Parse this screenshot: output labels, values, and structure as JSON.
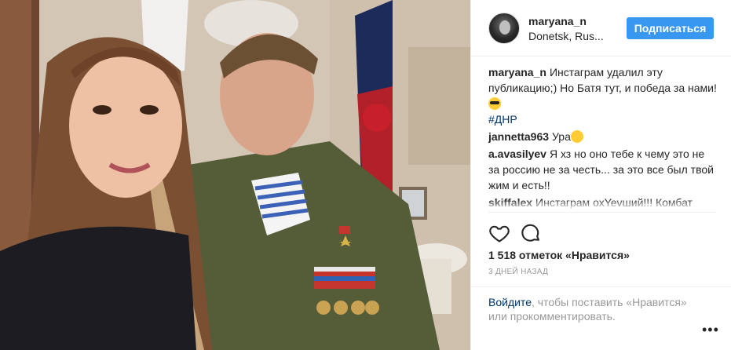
{
  "post": {
    "username": "maryana_n",
    "location": "Donetsk, Rus...",
    "follow_label": "Подписаться"
  },
  "comments": [
    {
      "user": "maryana_n",
      "text": "Инстаграм удалил эту публикацию;) Но Батя тут, и победа за нами!",
      "emoji": "smiling-face-with-sunglasses",
      "hashtag": "#ДНР"
    },
    {
      "user": "jannetta963",
      "text": "Ура",
      "emoji": "smiling-face"
    },
    {
      "user": "a.avasilyev",
      "text": "Я хз но оно тебе к чему это не за россию не за честь... за это все был твой жим и есть!!"
    },
    {
      "user": "skiffalex",
      "text": "Инстаграм охYevший!!! Комбат батяня!!!!"
    }
  ],
  "actions": {
    "like_icon": "heart-icon",
    "comment_icon": "comment-bubble-icon",
    "likes_text": "1 518 отметок «Нравится»",
    "time_text": "3 ДНЕЙ НАЗАД"
  },
  "login": {
    "link_text": "Войдите",
    "rest_text": ", чтобы поставить «Нравится» или прокомментировать.",
    "more_label": "•••"
  },
  "colors": {
    "accent": "#3897f0",
    "link": "#003569",
    "muted": "#999999",
    "text": "#262626"
  }
}
